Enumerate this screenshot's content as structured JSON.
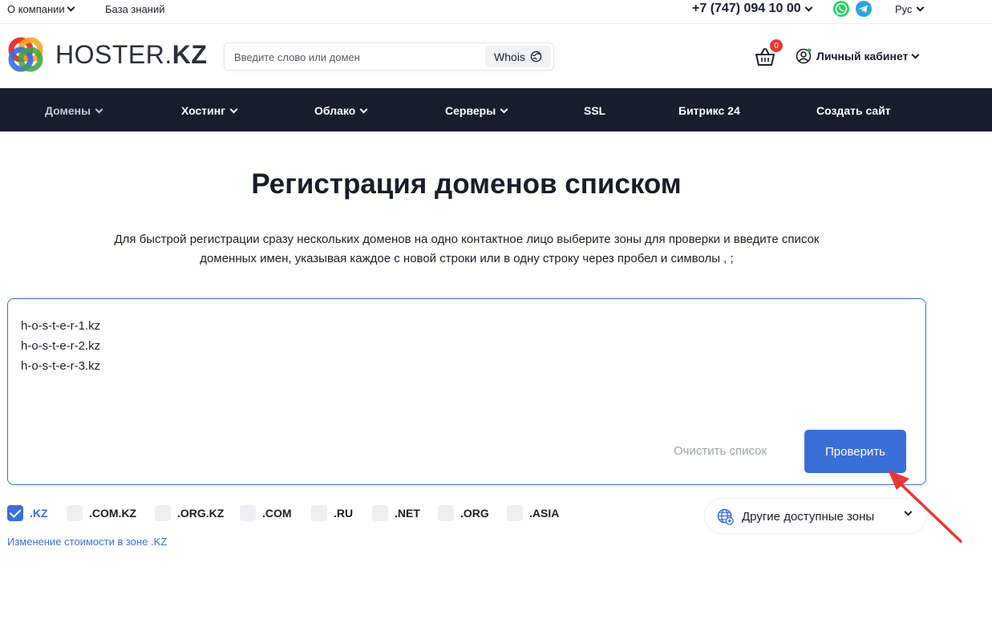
{
  "topbar": {
    "about": "О компании",
    "kb": "База знаний",
    "phone": "+7 (747) 094 10 00",
    "lang": "Рус"
  },
  "header": {
    "logo_main": "HOSTER.",
    "logo_accent": "KZ",
    "search_placeholder": "Введите слово или домен",
    "whois": "Whois",
    "cart_count": "0",
    "account": "Личный кабинет"
  },
  "nav": {
    "items": [
      {
        "label": "Домены"
      },
      {
        "label": "Хостинг"
      },
      {
        "label": "Облако"
      },
      {
        "label": "Серверы"
      },
      {
        "label": "SSL"
      },
      {
        "label": "Битрикс 24"
      },
      {
        "label": "Создать сайт"
      }
    ]
  },
  "main": {
    "title": "Регистрация доменов списком",
    "description_line1": "Для быстрой регистрации сразу нескольких доменов на одно контактное лицо выберите зоны для проверки и введите список",
    "description_line2": "доменных имен, указывая каждое с новой строки или в одну строку через пробел и символы , ;",
    "domains": [
      "h-o-s-t-e-r-1.kz",
      "h-o-s-t-e-r-2.kz",
      "h-o-s-t-e-r-3.kz"
    ],
    "clear": "Очистить список",
    "check": "Проверить",
    "zones": [
      {
        "label": ".KZ",
        "checked": true
      },
      {
        "label": ".COM.KZ",
        "checked": false
      },
      {
        "label": ".ORG.KZ",
        "checked": false
      },
      {
        "label": ".COM",
        "checked": false
      },
      {
        "label": ".RU",
        "checked": false
      },
      {
        "label": ".NET",
        "checked": false
      },
      {
        "label": ".ORG",
        "checked": false
      },
      {
        "label": ".ASIA",
        "checked": false
      }
    ],
    "price_link": "Изменение стоимости в зоне .KZ",
    "other_zones": "Другие доступные зоны"
  },
  "colors": {
    "accent": "#3a6fd8",
    "nav_bg": "#161d2c",
    "badge": "#e53935",
    "whatsapp": "#25d366",
    "telegram": "#2aa3e0",
    "annotation_arrow": "#e53935"
  }
}
